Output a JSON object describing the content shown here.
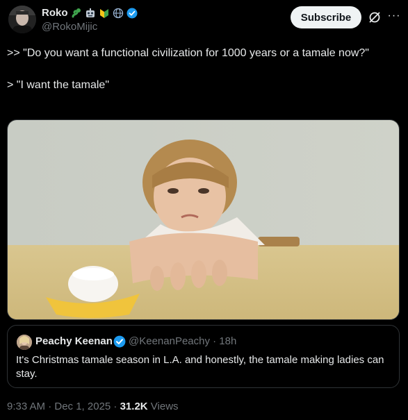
{
  "author": {
    "name": "Roko",
    "handle": "@RokoMijic",
    "badges": [
      "snake-emoji",
      "robot-emoji",
      "beginner-emoji",
      "globe-icon",
      "verified-badge"
    ]
  },
  "actions": {
    "subscribe_label": "Subscribe",
    "grok_icon": "grok-icon",
    "more_icon": "more-icon"
  },
  "tweet": {
    "text": ">> \"Do you want a functional civilization for 1000 years or a tamale now?\"\n\n> \"I want the tamale\""
  },
  "media": {
    "image": "photo-child-marshmallow"
  },
  "quote": {
    "name": "Peachy Keenan",
    "handle_time": "@KeenanPeachy · 18h",
    "text": "It's Christmas tamale season in L.A. and honestly, the tamale making ladies can stay."
  },
  "meta": {
    "time_date": "9:33 AM · Dec 1, 2025 · ",
    "views_count": "31.2K",
    "views_label": " Views"
  },
  "colors": {
    "background": "#000000",
    "text": "#e7e9ea",
    "muted": "#71767b",
    "verified": "#1d9bf0",
    "border": "#2f3336"
  }
}
